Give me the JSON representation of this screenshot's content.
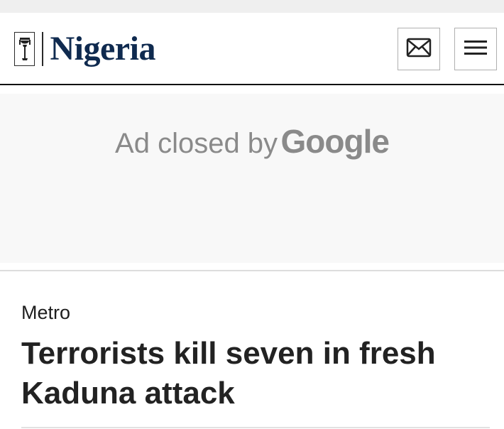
{
  "header": {
    "site_name": "Nigeria",
    "logo_icon": "coat-of-arms-emblem",
    "mail_button_icon": "envelope-icon",
    "menu_button_icon": "hamburger-menu-icon",
    "brand_color": "#0f2a4f"
  },
  "ad": {
    "text_prefix": "Ad closed by",
    "text_brand": "Google"
  },
  "article": {
    "category": "Metro",
    "headline": "Terrorists kill seven in fresh Kaduna attack"
  }
}
